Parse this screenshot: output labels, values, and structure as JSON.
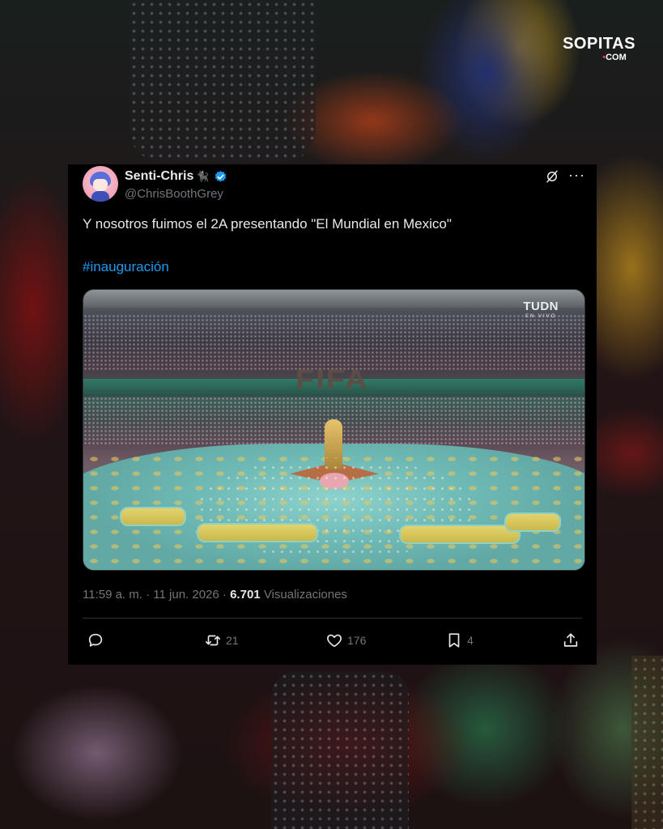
{
  "brand": {
    "name": "SOPITAS",
    "domain_dot": "•",
    "domain": "COM"
  },
  "tweet": {
    "display_name": "Senti-Chris",
    "name_emoji": "🐈‍⬛",
    "handle": "@ChrisBoothGrey",
    "verified": true,
    "text": "Y nosotros fuimos el 2A presentando \"El Mundial en Mexico\"",
    "hashtag": "#inauguración",
    "media": {
      "broadcaster_logo": "TUDN",
      "broadcaster_sub": "EN VIVO",
      "stadium_sign": "FIFA"
    },
    "meta": {
      "time": "11:59 a. m.",
      "separator": " · ",
      "date": "11 jun. 2026",
      "views_count": "6.701",
      "views_label": "Visualizaciones"
    },
    "actions": {
      "replies": "",
      "retweets": "21",
      "likes": "176",
      "bookmarks": "4"
    },
    "icons": [
      "grok-icon",
      "more-icon",
      "reply-icon",
      "retweet-icon",
      "like-icon",
      "bookmark-icon",
      "share-icon",
      "verified-icon"
    ]
  },
  "colors": {
    "card_bg": "#000000",
    "text_primary": "#e7e9ea",
    "text_secondary": "#71767b",
    "link": "#1d9bf0",
    "brand_pink": "#e8337f"
  }
}
